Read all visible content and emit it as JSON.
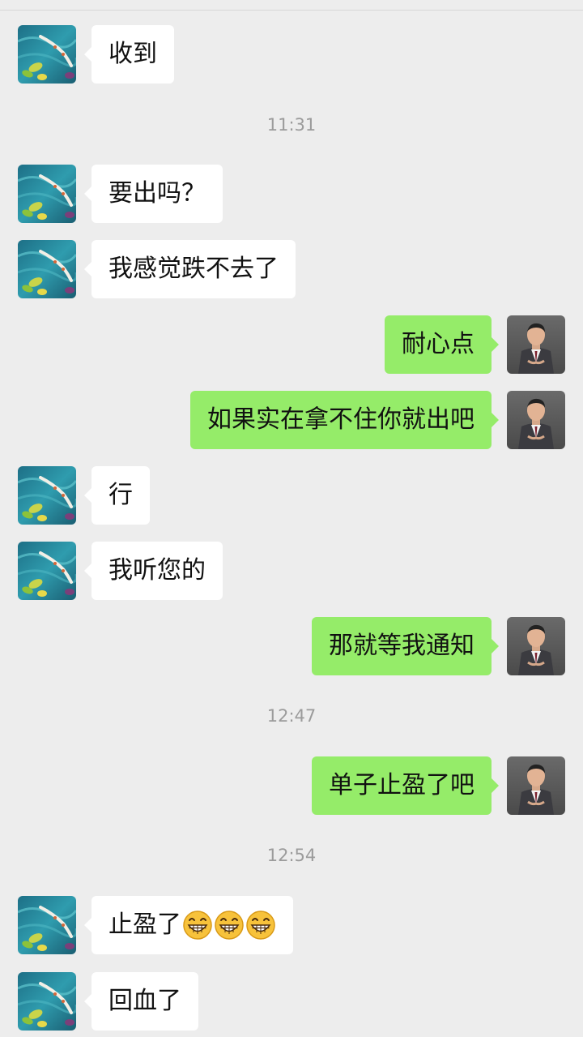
{
  "chat": {
    "messages": [
      {
        "text": "收到"
      },
      {
        "time": "11:31"
      },
      {
        "text": "要出吗？"
      },
      {
        "text": "我感觉跌不去了"
      },
      {
        "text": "耐心点"
      },
      {
        "text": "如果实在拿不住你就出吧"
      },
      {
        "text": "行"
      },
      {
        "text": "我听您的"
      },
      {
        "text": "那就等我通知"
      },
      {
        "time": "12:47"
      },
      {
        "text": "单子止盈了吧"
      },
      {
        "time": "12:54"
      },
      {
        "text": "止盈了",
        "emojis": [
          "grin-emoji",
          "grin-emoji",
          "grin-emoji"
        ]
      },
      {
        "text": "回血了"
      }
    ]
  },
  "colors": {
    "background": "#ededed",
    "incoming_bubble": "#ffffff",
    "outgoing_bubble": "#95ec69",
    "timestamp_text": "#9b9b9b"
  },
  "icons": {
    "incoming_avatar": "koi-pond-avatar",
    "outgoing_avatar": "man-in-suit-avatar"
  }
}
